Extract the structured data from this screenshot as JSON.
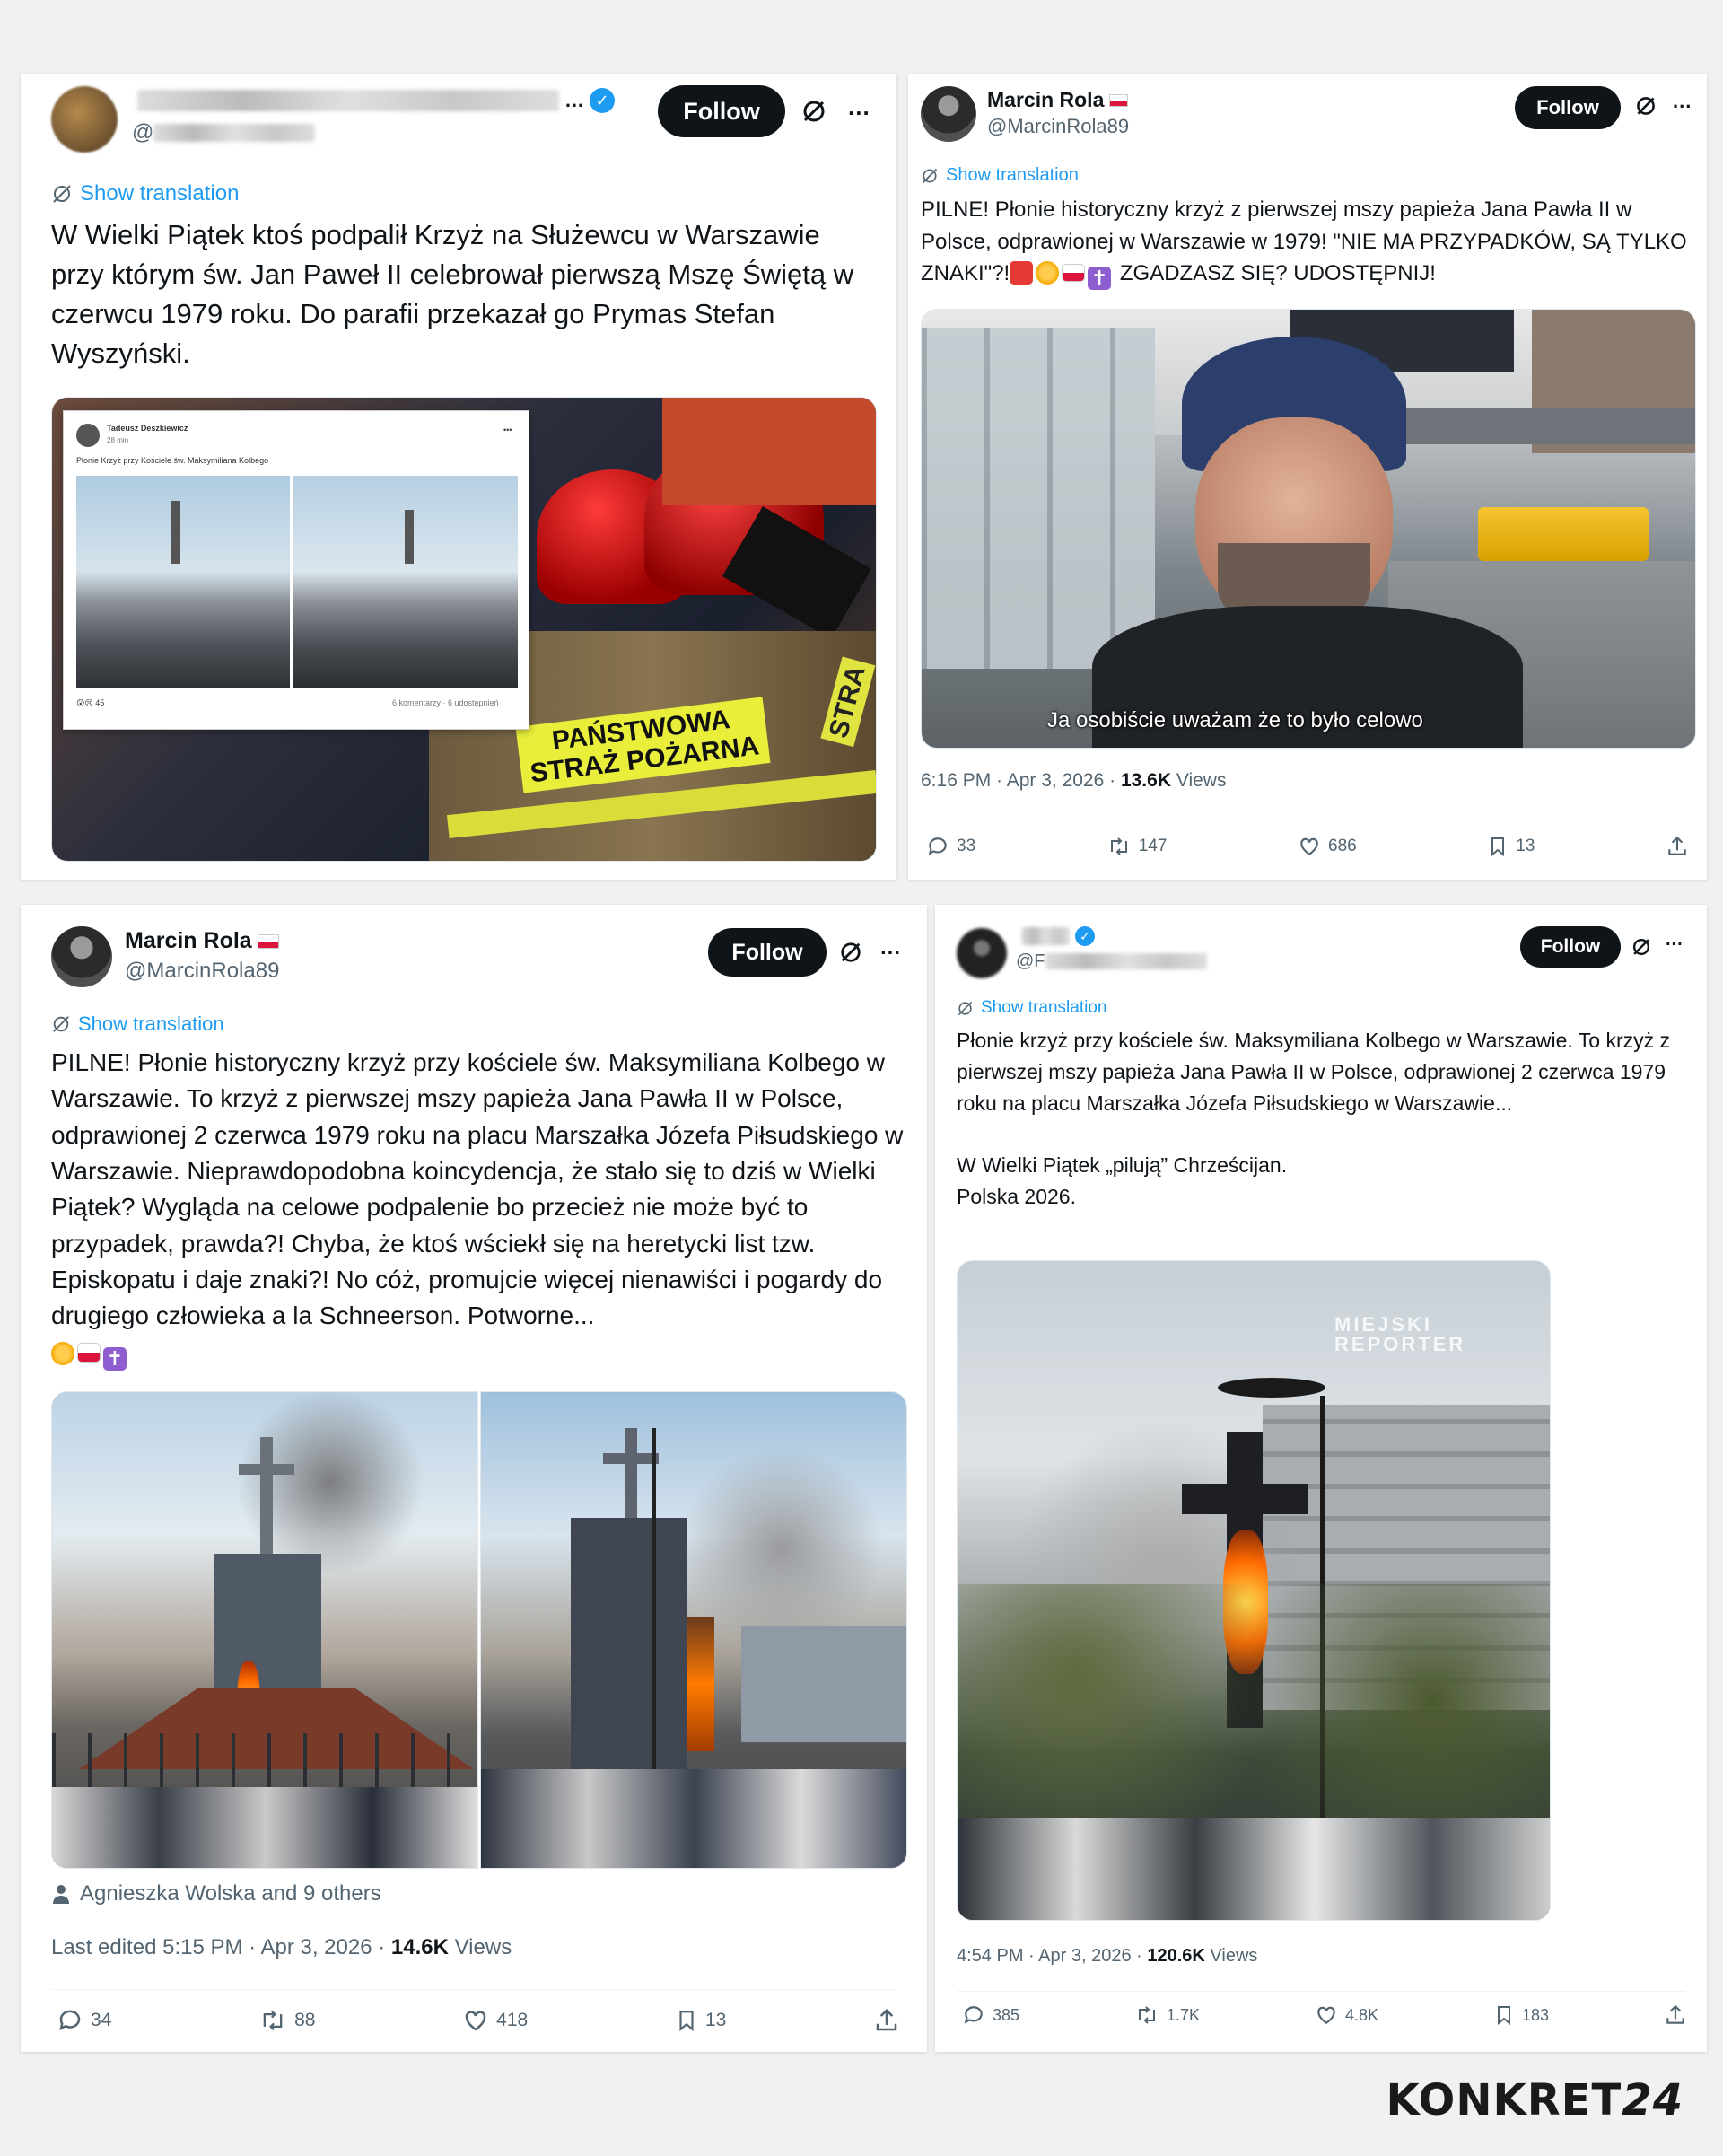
{
  "tweets": [
    {
      "author_name": "",
      "handle": "@",
      "follow_label": "Follow",
      "more_label": "...",
      "show_translation": "Show translation",
      "text": "W Wielki Piątek ktoś podpalił Krzyż na Służewcu w Warszawie przy którym św. Jan Paweł II celebrował pierwszą Mszę Świętą w czerwcu 1979 roku. Do parafii przekazał go Prymas Stefan Wyszyński.",
      "media": {
        "fb_author": "Tadeusz Deszkiewicz",
        "fb_time": "28 min",
        "fb_text": "Płonie Krzyż przy Kościele św. Maksymiliana Kolbego",
        "fb_reactions": "45",
        "fb_comments": "6 komentarzy",
        "fb_shares": "6 udostępnień",
        "vest_text_line1": "PAŃSTWOWA",
        "vest_text_line2": "STRAŻ POŻARNA",
        "vest_side": "STRA"
      }
    },
    {
      "author_name": "Marcin Rola",
      "handle": "@MarcinRola89",
      "follow_label": "Follow",
      "more_label": "...",
      "show_translation": "Show translation",
      "text_main": "PILNE! Płonie historyczny krzyż z pierwszej mszy papieża Jana Pawła II w Polsce, odprawionej w Warszawie w 1979! \"NIE MA PRZYPADKÓW, SĄ TYLKO ZNAKI\"?!",
      "text_tail": " ZGADZASZ SIĘ? UDOSTĘPNIJ!",
      "video_subtitle": "Ja osobiście uważam że to było celowo",
      "meta_time": "6:16 PM · Apr 3, 2026 · ",
      "meta_views": "13.6K",
      "meta_views_label": " Views",
      "replies": "33",
      "reposts": "147",
      "likes": "686",
      "bookmarks": "13"
    },
    {
      "author_name": "Marcin Rola",
      "handle": "@MarcinRola89",
      "follow_label": "Follow",
      "more_label": "...",
      "show_translation": "Show translation",
      "text": "PILNE! Płonie historyczny krzyż przy kościele św. Maksymiliana Kolbego w Warszawie. To krzyż z pierwszej mszy papieża Jana Pawła II w Polsce, odprawionej 2 czerwca 1979 roku na placu Marszałka Józefa Piłsudskiego w Warszawie. Nieprawdopodobna koincydencja, że stało się to dziś w Wielki Piątek? Wygląda na celowe podpalenie bo przecież nie może być to przypadek, prawda?! Chyba, że ktoś wściekł się na heretycki list tzw. Episkopatu i daje znaki?! No cóż, promujcie więcej nienawiści i pogardy do drugiego człowieka a la Schneerson. Potworne...",
      "likers": "Agnieszka Wolska and 9 others",
      "meta_time": "Last edited 5:15 PM · Apr 3, 2026 · ",
      "meta_views": "14.6K",
      "meta_views_label": " Views",
      "replies": "34",
      "reposts": "88",
      "likes": "418",
      "bookmarks": "13"
    },
    {
      "author_name": "",
      "handle": "@F",
      "follow_label": "Follow",
      "more_label": "...",
      "show_translation": "Show translation",
      "text_p1": "Płonie krzyż przy kościele św. Maksymiliana Kolbego w Warszawie. To krzyż z pierwszej mszy papieża Jana Pawła II w Polsce, odprawionej 2 czerwca 1979 roku na placu Marszałka Józefa Piłsudskiego w Warszawie...",
      "text_p2": "W Wielki Piątek „pilują” Chrześcijan.",
      "text_p3": "Polska 2026.",
      "watermark_line1": "MIEJSKI",
      "watermark_line2": "REPORTER",
      "meta_time": "4:54 PM · Apr 3, 2026 · ",
      "meta_views": "120.6K",
      "meta_views_label": " Views",
      "replies": "385",
      "reposts": "1.7K",
      "likes": "4.8K",
      "bookmarks": "183"
    }
  ],
  "logo": {
    "word": "KONKRET",
    "num": "24"
  },
  "colors": {
    "accent": "#1d9bf0",
    "follow_bg": "#0f1419",
    "muted": "#536471"
  }
}
